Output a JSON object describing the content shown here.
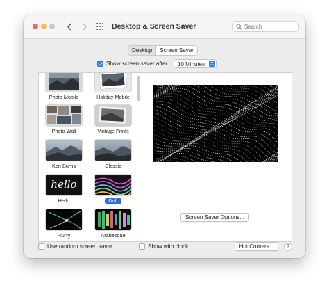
{
  "window": {
    "title": "Desktop & Screen Saver",
    "search_placeholder": "Search",
    "traffic_lights": {
      "close": "#ee6a5f",
      "minimize": "#f5be4f",
      "zoom": "#c8c8c8"
    },
    "icons": {
      "back": "chevron-left-icon",
      "forward": "chevron-right-icon",
      "show_all": "grid-icon",
      "search": "magnifier-icon"
    }
  },
  "tabs": [
    {
      "label": "Desktop",
      "selected": false
    },
    {
      "label": "Screen Saver",
      "selected": true
    }
  ],
  "show_screen_saver": {
    "label": "Show screen saver after",
    "checked": true,
    "delay": "10 Minutes"
  },
  "savers": [
    {
      "label": "Photo Mobile",
      "selected": false
    },
    {
      "label": "Holiday Mobile",
      "selected": false
    },
    {
      "label": "Photo Wall",
      "selected": false
    },
    {
      "label": "Vintage Prints",
      "selected": false
    },
    {
      "label": "Ken Burns",
      "selected": false
    },
    {
      "label": "Classic",
      "selected": false
    },
    {
      "label": "Hello",
      "thumb_text": "hello",
      "selected": false
    },
    {
      "label": "Drift",
      "selected": true
    },
    {
      "label": "Flurry",
      "selected": false
    },
    {
      "label": "Arabesque",
      "selected": false
    }
  ],
  "options_button": "Screen Saver Options...",
  "footer": {
    "random": {
      "label": "Use random screen saver",
      "checked": false
    },
    "clock": {
      "label": "Show with clock",
      "checked": false
    },
    "hot_corners": "Hot Corners...",
    "help": "?"
  },
  "accent_color": "#2d7cf6"
}
